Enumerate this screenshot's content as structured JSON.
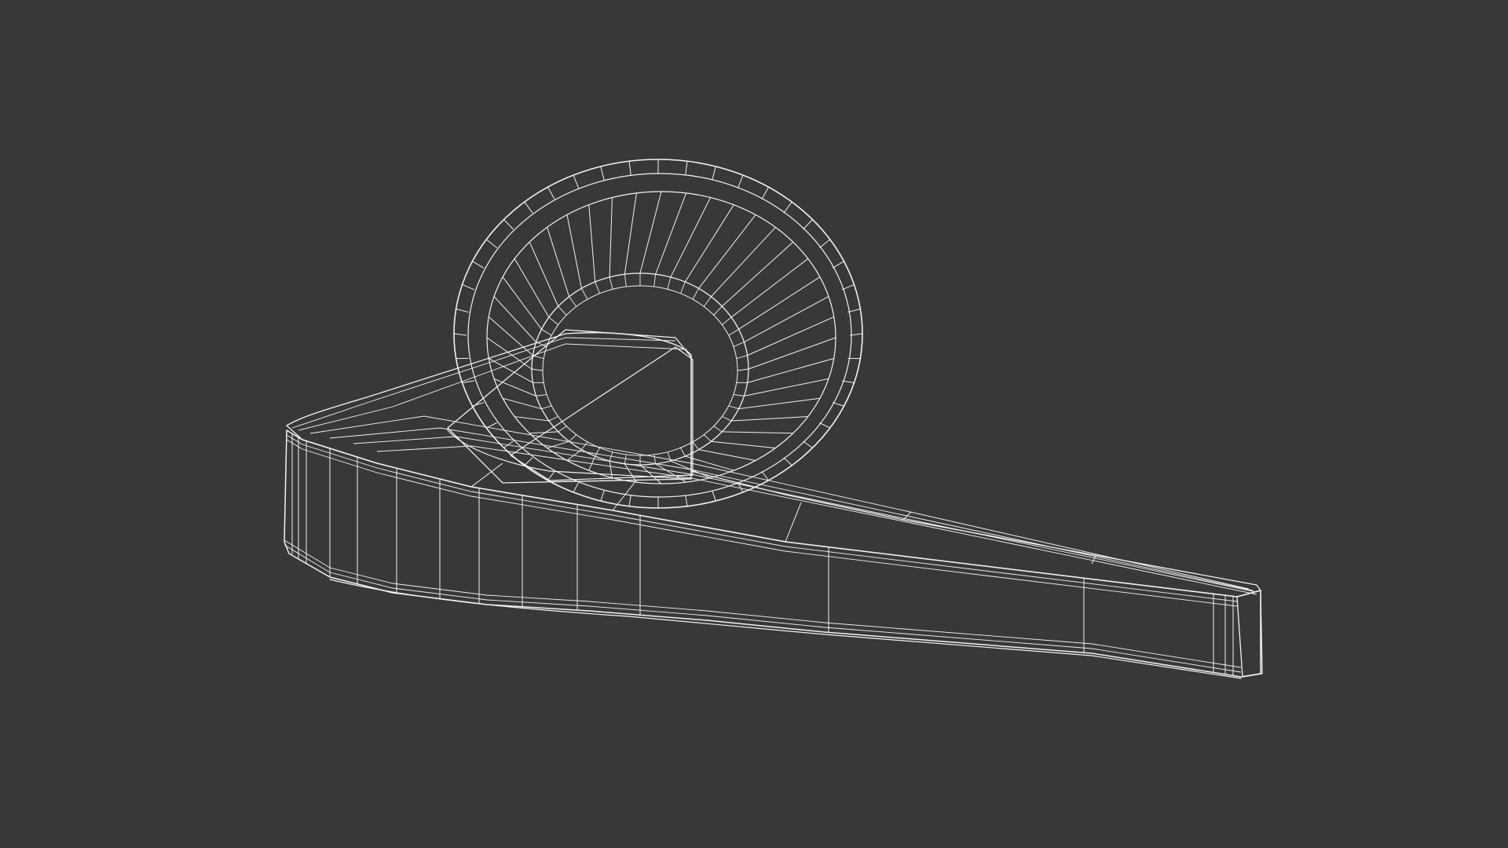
{
  "scene": {
    "background_color": "#383838",
    "surface_color": "#6b6b6b",
    "surface_dark_color": "#555555",
    "wire_color": "#f2f2f2",
    "render_mode": "wireframe-on-shaded",
    "subject": "door-lever-handle-with-round-rosette"
  }
}
